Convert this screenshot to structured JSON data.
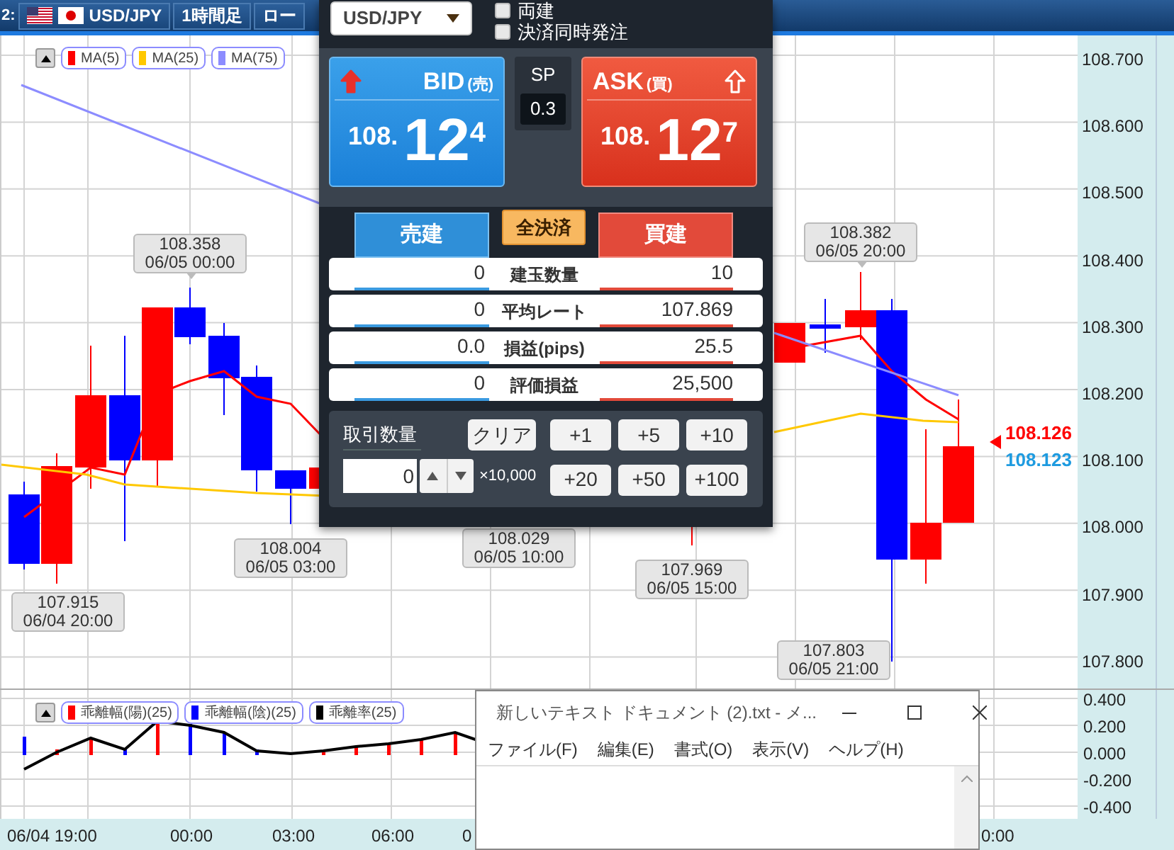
{
  "header": {
    "index": "2:",
    "fields": [
      {
        "label": "USD/JPY",
        "flags": true
      },
      {
        "label": "1時間足",
        "flags": false
      },
      {
        "label": "ロー",
        "flags": false
      }
    ]
  },
  "chart": {
    "legend": [
      {
        "label": "MA(5)",
        "color": "#ff0000"
      },
      {
        "label": "MA(25)",
        "color": "#ffc800"
      },
      {
        "label": "MA(75)",
        "color": "#8c8cff"
      }
    ],
    "price_axis": [
      "108.700",
      "108.600",
      "108.500",
      "108.400",
      "108.300",
      "108.200",
      "108.100",
      "108.000",
      "107.900",
      "107.800"
    ],
    "callouts": [
      {
        "price": "108.358",
        "time": "06/05 00:00"
      },
      {
        "price": "107.915",
        "time": "06/04 20:00"
      },
      {
        "price": "108.004",
        "time": "06/05 03:00"
      },
      {
        "price": "108.029",
        "time": "06/05 10:00"
      },
      {
        "price": "107.969",
        "time": "06/05 15:00"
      },
      {
        "price": "108.382",
        "time": "06/05 20:00"
      },
      {
        "price": "107.803",
        "time": "06/05 21:00"
      }
    ],
    "price_markers": [
      {
        "value": "108.126",
        "color": "#ff0000"
      },
      {
        "value": "108.123",
        "color": "#1e9be0"
      }
    ]
  },
  "indicator": {
    "legend": [
      {
        "label": "乖離幅(陽)(25)",
        "color": "#ff0000"
      },
      {
        "label": "乖離幅(陰)(25)",
        "color": "#0000ff"
      },
      {
        "label": "乖離率(25)",
        "color": "#000000"
      }
    ],
    "axis": [
      "0.400",
      "0.200",
      "0.000",
      "-0.200",
      "-0.400"
    ]
  },
  "time_axis": [
    "06/04 19:00",
    "00:00",
    "03:00",
    "06:00",
    "0",
    "0:00"
  ],
  "order_panel": {
    "symbol": "USD/JPY",
    "checkboxes": [
      {
        "label": "両建",
        "checked": false
      },
      {
        "label": "決済同時発注",
        "checked": false
      }
    ],
    "bid": {
      "label": "BID",
      "sub": "(売)",
      "prefix": "108.",
      "main": "12",
      "pip": "4"
    },
    "spread": {
      "label": "SP",
      "value": "0.3"
    },
    "ask": {
      "label": "ASK",
      "sub": "(買)",
      "prefix": "108.",
      "main": "12",
      "pip": "7"
    },
    "sell": "売建",
    "close_all": "全決済",
    "buy": "買建",
    "rows": [
      {
        "sell": "0",
        "label": "建玉数量",
        "buy": "10"
      },
      {
        "sell": "0",
        "label": "平均レート",
        "buy": "107.869"
      },
      {
        "sell": "0.0",
        "label": "損益(pips)",
        "buy": "25.5"
      },
      {
        "sell": "0",
        "label": "評価損益",
        "buy": "25,500"
      }
    ],
    "quantity": {
      "label": "取引数量",
      "value": "0",
      "unit": "×10,000",
      "clear": "クリア",
      "increments": [
        "+1",
        "+5",
        "+10",
        "+20",
        "+50",
        "+100"
      ]
    }
  },
  "notepad": {
    "title": "新しいテキスト ドキュメント (2).txt - メ...",
    "menu": [
      "ファイル(F)",
      "編集(E)",
      "書式(O)",
      "表示(V)",
      "ヘルプ(H)"
    ]
  }
}
